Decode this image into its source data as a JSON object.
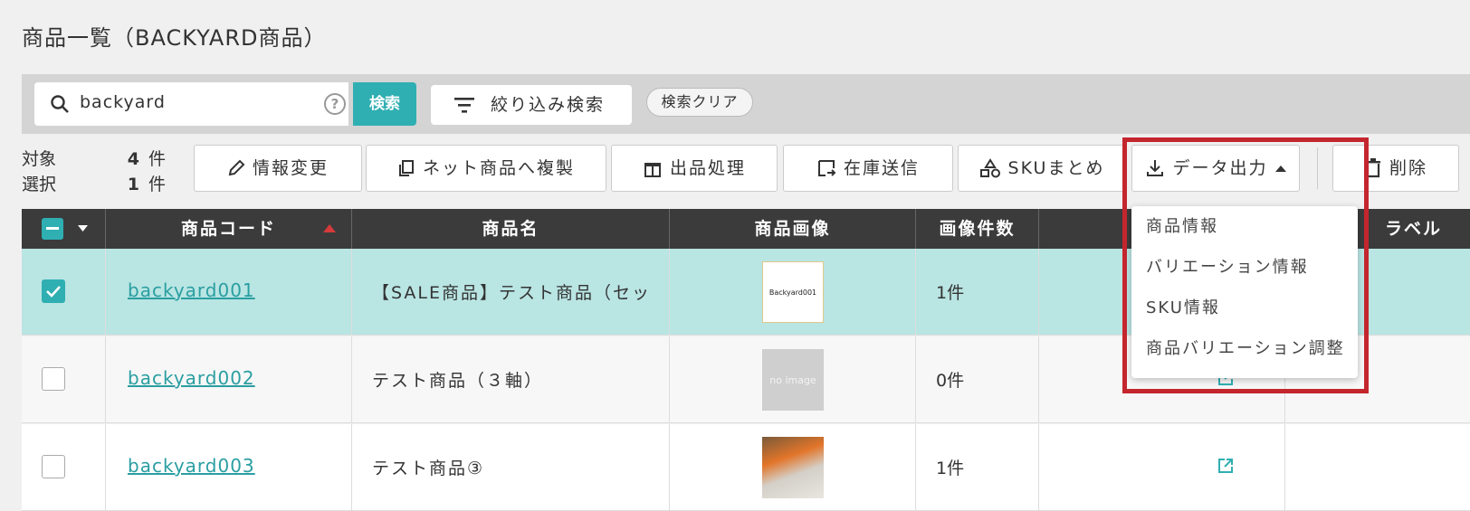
{
  "page": {
    "title": "商品一覧（BACKYARD商品）"
  },
  "search": {
    "value": "backyard",
    "button": "検索",
    "filter_button": "絞り込み検索",
    "clear_button": "検索クリア"
  },
  "counts": {
    "target_label": "対象",
    "target_count": "4",
    "selected_label": "選択",
    "selected_count": "1",
    "unit": "件"
  },
  "actions": {
    "edit": "情報変更",
    "copy_net": "ネット商品へ複製",
    "listing": "出品処理",
    "stock_send": "在庫送信",
    "sku_merge": "SKUまとめ",
    "data_output": "データ出力",
    "delete": "削除"
  },
  "table": {
    "columns": {
      "code": "商品コード",
      "name": "商品名",
      "image": "商品画像",
      "image_count": "画像件数",
      "label": "ラベル"
    },
    "rows": [
      {
        "code": "backyard001",
        "name": "【SALE商品】テスト商品（セッ",
        "image_text": "Backyard001",
        "count": "1件",
        "checked": true
      },
      {
        "code": "backyard002",
        "name": "テスト商品（３軸）",
        "image_text": "no image",
        "count": "0件",
        "checked": false
      },
      {
        "code": "backyard003",
        "name": "テスト商品③",
        "image_text": "",
        "count": "1件",
        "checked": false
      }
    ]
  },
  "dropdown": {
    "items": [
      "商品情報",
      "バリエーション情報",
      "SKU情報",
      "商品バリエーション調整"
    ]
  },
  "colors": {
    "accent": "#2fafb2",
    "selected_row": "#b9e5e3",
    "highlight": "#c4262e",
    "header": "#3b3b3b"
  }
}
